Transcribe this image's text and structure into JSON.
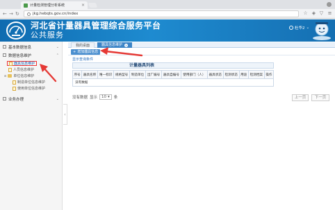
{
  "browser": {
    "tab_title": "计量检测管理分析系统",
    "url": "jkg.hebqts.gov.cn/index"
  },
  "header": {
    "title": "河北省计量器具管理综合服务平台",
    "subtitle": "公共服务",
    "user": "杜华2"
  },
  "sidebar": {
    "sections": [
      {
        "label": "基本数据信息"
      },
      {
        "label": "数据信息维护"
      },
      {
        "label": "业务办理"
      }
    ],
    "items": [
      {
        "label": "器具信息维护"
      },
      {
        "label": "人员信息维护"
      },
      {
        "label": "单位信息维护"
      },
      {
        "label": "制造单位信息维护"
      },
      {
        "label": "使用单位信息维护"
      }
    ]
  },
  "tabs": [
    {
      "label": "我的桌面"
    },
    {
      "label": "器具信息维护"
    }
  ],
  "toolbar": {
    "add_label": "增加器具信息"
  },
  "conditions_link": "显示查询条件",
  "table": {
    "title": "计量器具列表",
    "columns": [
      "序号",
      "器具名称",
      "唯一标识",
      "规格型号",
      "制造单位",
      "出厂编号",
      "器具自编号",
      "使用部门（人）",
      "器具状态",
      "检测状态",
      "用途",
      "检测档案",
      "操作"
    ],
    "empty_text": "没有数据"
  },
  "pager": {
    "no_data": "没有数据",
    "show_label": "显示",
    "page_size": "10",
    "unit": "条",
    "prev": "上一页",
    "next": "下一页"
  },
  "colors": {
    "header_blue": "#156fb2",
    "accent_blue": "#3b84c7",
    "arrow_red": "#e53935"
  }
}
